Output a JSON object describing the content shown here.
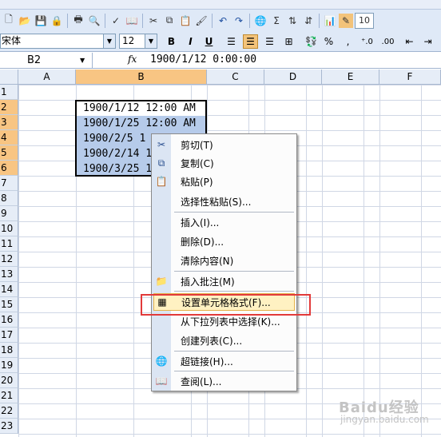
{
  "toolbar": {
    "zoom_partial": "10"
  },
  "format_bar": {
    "font_name": "宋体",
    "font_size": "12",
    "bold": "B",
    "italic": "I",
    "underline": "U",
    "currency": "%",
    "comma": ",",
    "inc_decimal": "⁺.0",
    "dec_decimal": ".00",
    "sum": "Σ"
  },
  "formula_bar": {
    "name_box": "B2",
    "fx": "fx",
    "value": "1900/1/12   0:00:00"
  },
  "columns": [
    "A",
    "B",
    "C",
    "D",
    "E",
    "F"
  ],
  "rows": [
    "1",
    "2",
    "3",
    "4",
    "5",
    "6",
    "7",
    "8",
    "9",
    "10",
    "11",
    "12",
    "13",
    "14",
    "15",
    "16",
    "17",
    "18",
    "19",
    "20",
    "21",
    "22",
    "23"
  ],
  "cells": [
    {
      "text": "1900/1/12 12:00 AM"
    },
    {
      "text": "1900/1/25 12:00 AM"
    },
    {
      "text": " 1900/2/5 1"
    },
    {
      "text": "1900/2/14 1"
    },
    {
      "text": "1900/3/25 1"
    }
  ],
  "context_menu": {
    "items": [
      {
        "label": "剪切(T)",
        "icon": "scissors-icon"
      },
      {
        "label": "复制(C)",
        "icon": "copy-icon"
      },
      {
        "label": "粘贴(P)",
        "icon": "paste-icon"
      },
      {
        "label": "选择性粘贴(S)...",
        "icon": ""
      },
      {
        "label": "插入(I)...",
        "icon": ""
      },
      {
        "label": "删除(D)...",
        "icon": ""
      },
      {
        "label": "清除内容(N)",
        "icon": ""
      },
      {
        "label": "插入批注(M)",
        "icon": "comment-icon"
      },
      {
        "label": "设置单元格格式(F)...",
        "icon": "format-cells-icon"
      },
      {
        "label": "从下拉列表中选择(K)...",
        "icon": ""
      },
      {
        "label": "创建列表(C)...",
        "icon": ""
      },
      {
        "label": "超链接(H)...",
        "icon": "hyperlink-icon"
      },
      {
        "label": "查阅(L)...",
        "icon": "research-icon"
      }
    ]
  },
  "watermark": {
    "text": "Baidu经验",
    "sub": "jingyan.baidu.com"
  }
}
